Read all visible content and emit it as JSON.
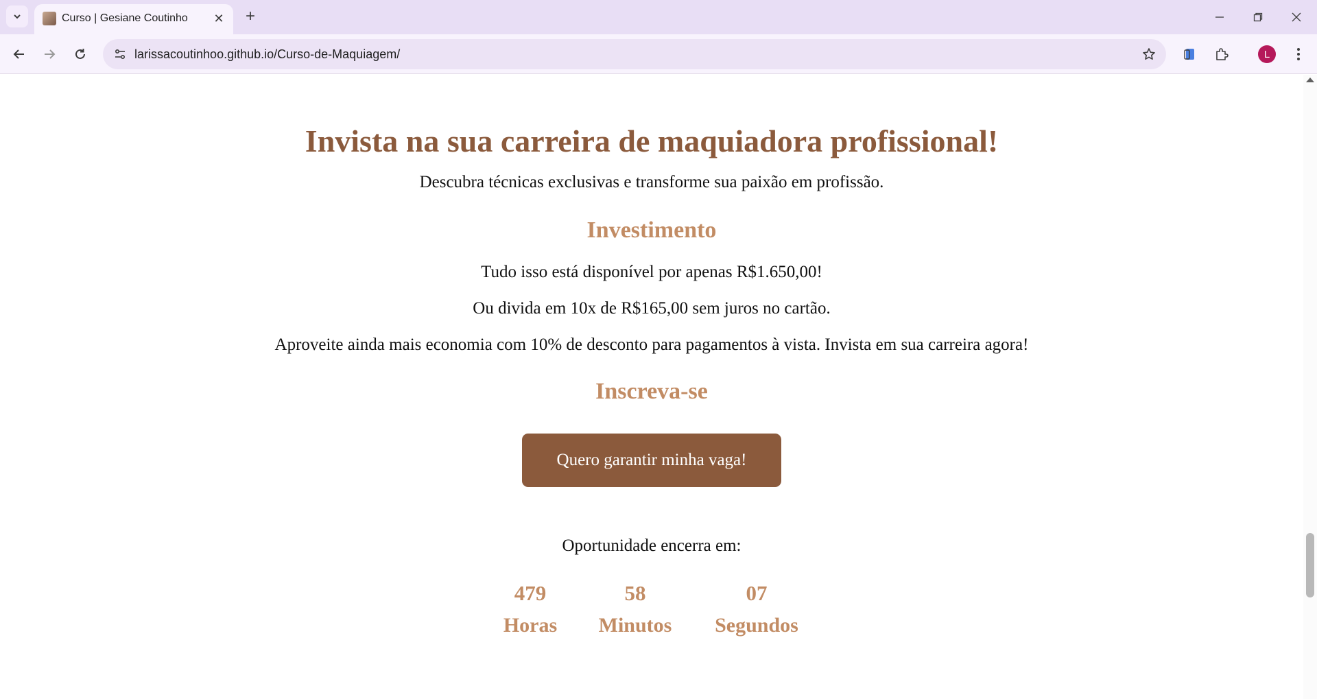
{
  "browser": {
    "tab_title": "Curso | Gesiane Coutinho",
    "tab_close": "✕",
    "new_tab": "+",
    "url_host": "larissacoutinhoo.github.io",
    "url_path": "/Curso-de-Maquiagem/",
    "avatar_letter": "L"
  },
  "page": {
    "headline": "Invista na sua carreira de maquiadora profissional!",
    "subline": "Descubra técnicas exclusivas e transforme sua paixão em profissão.",
    "investment": {
      "title": "Investimento",
      "lines": [
        "Tudo isso está disponível por apenas R$1.650,00!",
        "Ou divida em 10x de R$165,00 sem juros no cartão.",
        "Aproveite ainda mais economia com 10% de desconto para pagamentos à vista. Invista em sua carreira agora!"
      ]
    },
    "signup": {
      "title": "Inscreva-se",
      "button_label": "Quero garantir minha vaga!"
    },
    "countdown": {
      "label": "Oportunidade encerra em:",
      "hours": "479",
      "hours_label": "Horas",
      "minutes": "58",
      "minutes_label": "Minutos",
      "seconds": "07",
      "seconds_label": "Segundos"
    }
  },
  "colors": {
    "brand_brown": "#8b5a3c",
    "accent_tan": "#c28c64",
    "tabstrip": "#e8def5"
  }
}
